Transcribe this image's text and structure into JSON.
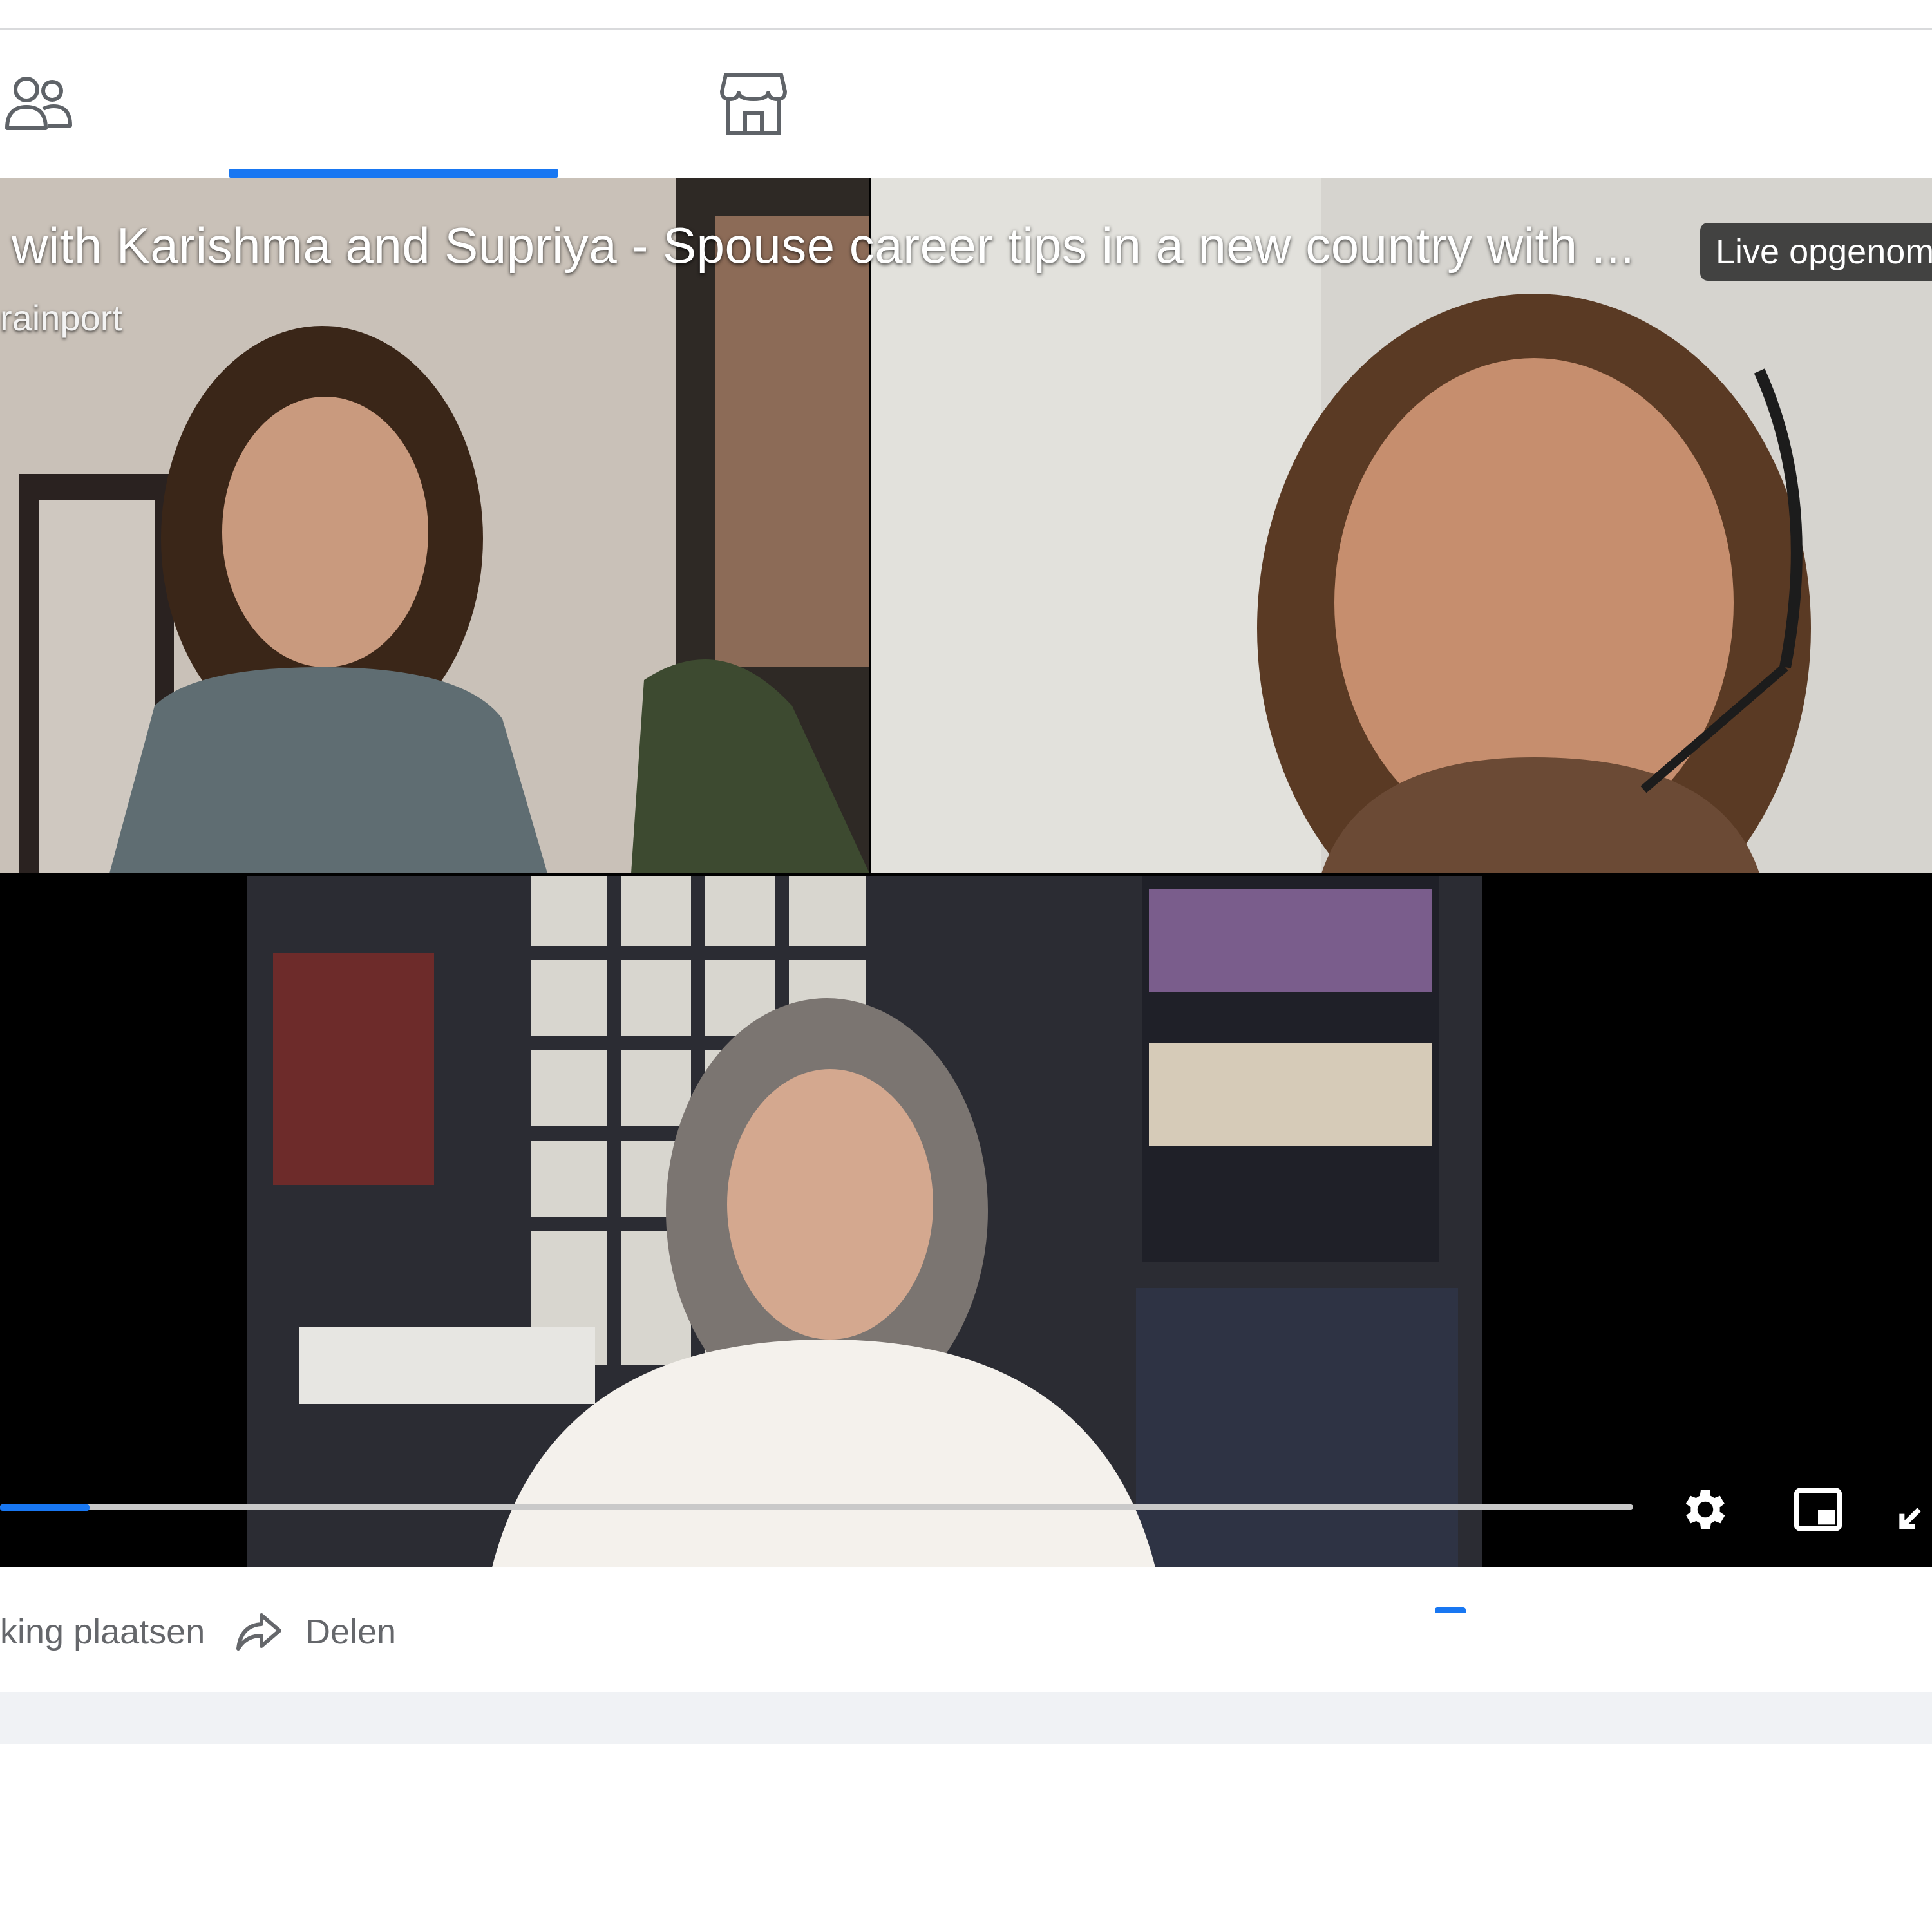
{
  "tabs": [
    {
      "name": "people",
      "icon": "people-icon"
    },
    {
      "name": "marketplace",
      "icon": "store-icon"
    }
  ],
  "video": {
    "title": "with Karishma and Supriya - Spouse career tips in a new country with ...",
    "channel": "rainport",
    "badge": "Live opgenome",
    "progress": 0.055
  },
  "actions": {
    "react_label": "king plaatsen",
    "share_label": "Delen"
  },
  "colors": {
    "accent": "#1877f2",
    "muted_text": "#65676b",
    "separator": "#f0f2f5"
  }
}
